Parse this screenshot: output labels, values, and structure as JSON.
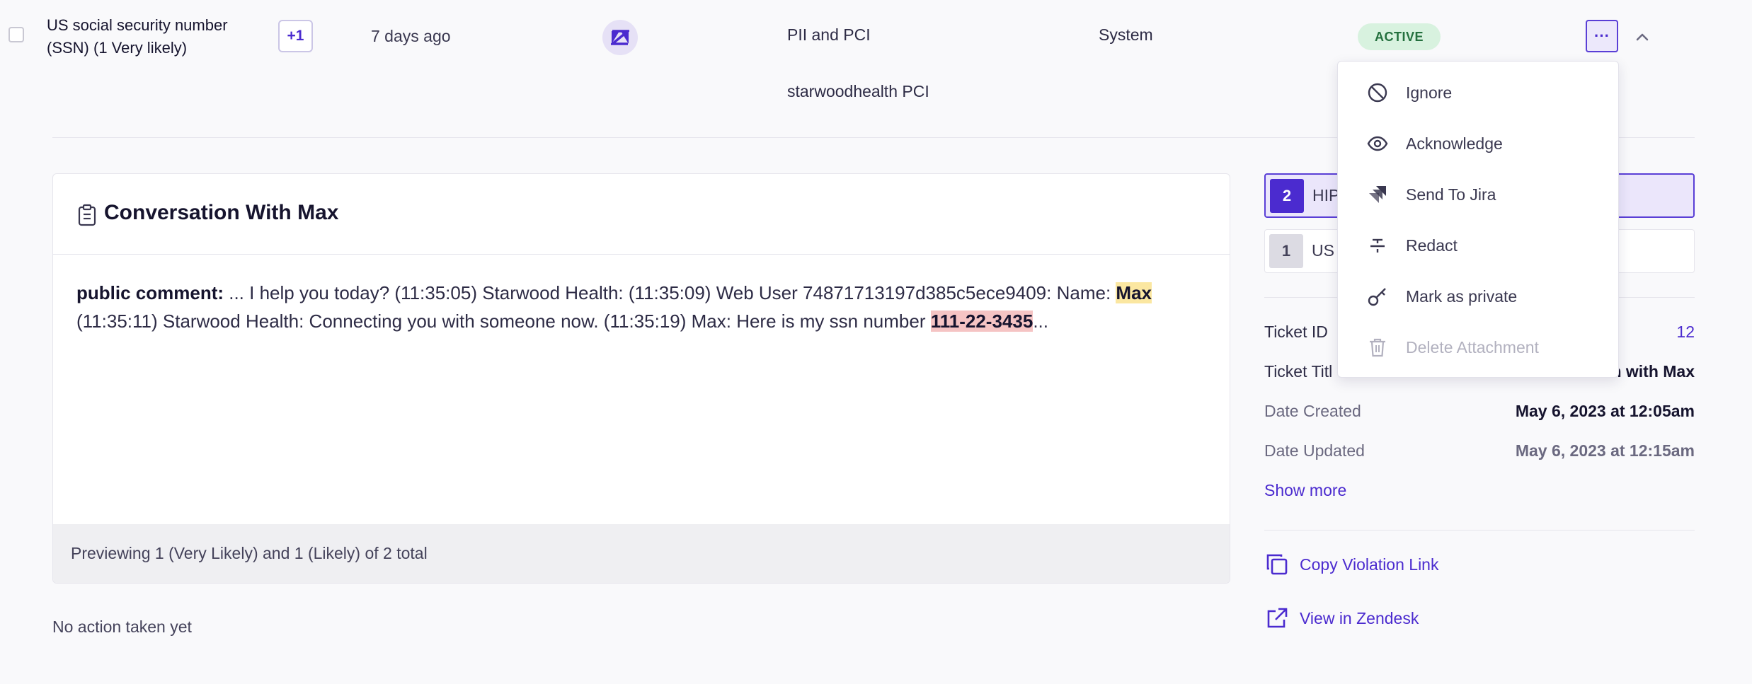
{
  "row": {
    "violation_name": "US social security number (SSN) (1 Very likely)",
    "extra_count": "+1",
    "time_ago": "7 days ago",
    "policy_type": "PII and PCI",
    "policy_name": "starwoodhealth PCI",
    "source": "System",
    "status": "ACTIVE",
    "more_label": "···"
  },
  "conversation": {
    "title": "Conversation With Max",
    "prefix": "public comment:",
    "text_1": " ... I help you today? (11:35:05) Starwood Health:  (11:35:09) Web User 74871713197d385c5ece9409: Name: ",
    "highlight_name": "Max",
    "text_2": " (11:35:11) Starwood Health: Connecting you with someone now. (11:35:19) Max: Here is my ssn number ",
    "highlight_ssn": "111-22-3435",
    "text_3": "...",
    "footer": "Previewing 1 (Very Likely) and 1 (Likely) of 2 total"
  },
  "no_action": "No action taken yet",
  "panel": {
    "tabs": [
      {
        "count": "2",
        "label": "HIP"
      },
      {
        "count": "1",
        "label": "US"
      }
    ],
    "details": [
      {
        "label": "Ticket ID",
        "value": "12"
      },
      {
        "label": "Ticket Titl",
        "value": "n with Max"
      },
      {
        "label": "Date Created",
        "value": "May 6, 2023 at 12:05am"
      },
      {
        "label": "Date Updated",
        "value": "May 6, 2023 at 12:15am"
      }
    ],
    "show_more": "Show more",
    "copy_link": "Copy Violation Link",
    "view_in": "View in Zendesk"
  },
  "menu": {
    "items": [
      {
        "label": "Ignore",
        "icon": "ban-icon"
      },
      {
        "label": "Acknowledge",
        "icon": "eye-icon"
      },
      {
        "label": "Send To Jira",
        "icon": "jira-icon"
      },
      {
        "label": "Redact",
        "icon": "strikethrough-icon"
      },
      {
        "label": "Mark as private",
        "icon": "key-icon"
      },
      {
        "label": "Delete Attachment",
        "icon": "trash-icon",
        "disabled": true
      }
    ]
  },
  "colors": {
    "accent": "#4b2bcf",
    "status_bg": "#d8f2df",
    "status_text": "#24703e",
    "highlight_name": "#fbe7a1",
    "highlight_ssn": "#f5c4c4"
  }
}
